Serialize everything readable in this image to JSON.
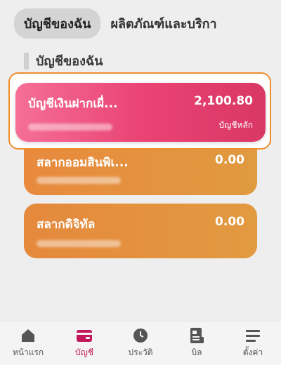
{
  "tabs": [
    {
      "label": "บัญชีของฉัน",
      "active": true
    },
    {
      "label": "ผลิตภัณฑ์และบริกา",
      "active": false
    }
  ],
  "section": {
    "title": "บัญชีของฉัน"
  },
  "accounts": [
    {
      "name": "บัญชีเงินฝากเผื่...",
      "amount": "2,100.80",
      "sub_label": "บัญชีหลัก",
      "color": "#ea4475"
    },
    {
      "name": "สลากออมสินพิเ...",
      "amount": "0.00",
      "color": "#e5903d"
    },
    {
      "name": "สลากดิจิทัล",
      "amount": "0.00",
      "color": "#e5903d"
    }
  ],
  "nav": [
    {
      "label": "หน้าแรก",
      "icon": "home-icon",
      "active": false
    },
    {
      "label": "บัญชี",
      "icon": "wallet-icon",
      "active": true
    },
    {
      "label": "ประวัติ",
      "icon": "clock-icon",
      "active": false
    },
    {
      "label": "บิล",
      "icon": "bill-icon",
      "active": false
    },
    {
      "label": "ตั้งค่า",
      "icon": "menu-icon",
      "active": false
    }
  ],
  "colors": {
    "accent": "#c2185b",
    "highlight_border": "#ef8d2e"
  }
}
